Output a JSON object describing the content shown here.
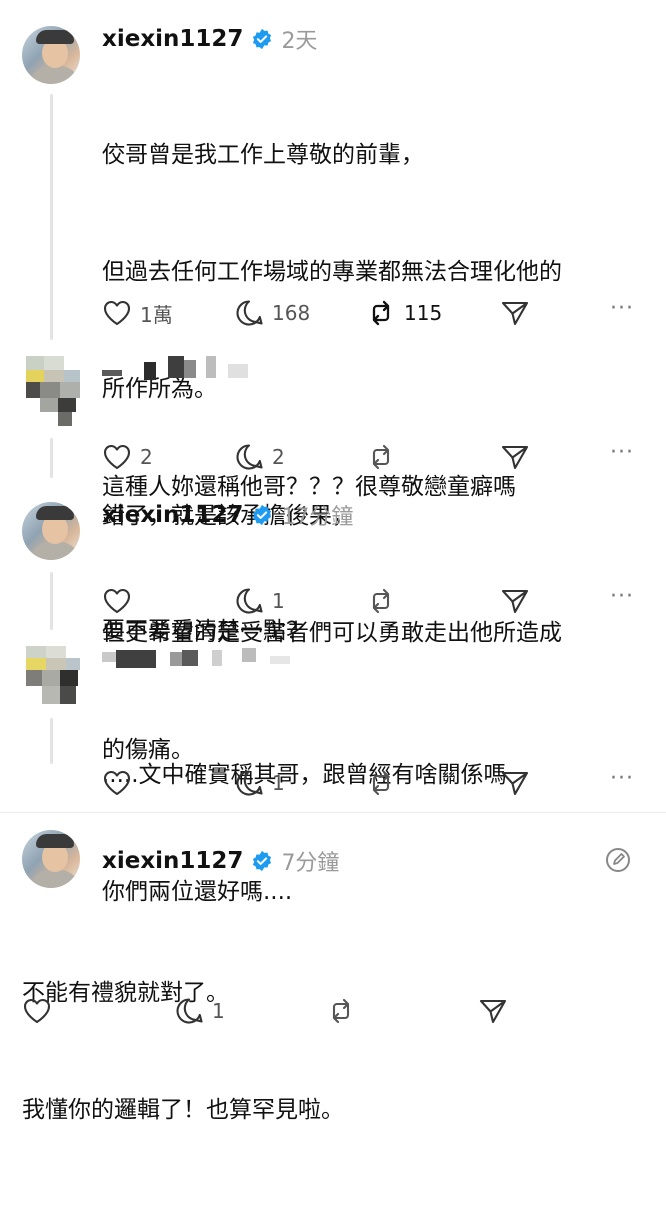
{
  "posts": [
    {
      "username": "xiexin1127",
      "time": "2天",
      "lines": [
        "佼哥曾是我工作上尊敬的前輩，",
        "但過去任何工作場域的專業都無法合理化他的",
        "所作所為。",
        "錯了，就是該承擔後果，",
        "但更希望的是受害者們可以勇敢走出他所造成",
        "的傷痛。"
      ],
      "likes": "1萬",
      "replies": "168",
      "reposts": "115",
      "more": "···"
    },
    {
      "username": "",
      "lines": [
        "這種人妳還稱他哥？？？很尊敬戀童癖嗎"
      ],
      "likes": "2",
      "replies": "2",
      "more": "···"
    },
    {
      "username": "xiexin1127",
      "time": "17分鐘",
      "lines": [
        "要不要看清楚一點？"
      ],
      "replies": "1",
      "more": "···"
    },
    {
      "username": "",
      "lines": [
        ".....文中確實稱其哥，跟曾經有啥關係嗎",
        "你們兩位還好嗎...."
      ],
      "replies": "1",
      "more": "···"
    },
    {
      "username": "xiexin1127",
      "time": "7分鐘",
      "lines": [
        "不能有禮貌就對了。",
        "我懂你的邏輯了！也算罕見啦。"
      ],
      "replies": "1"
    }
  ],
  "colors": {
    "verified": "#1d9bf0",
    "muted": "#9a9a9a",
    "text": "#111111"
  },
  "icons": [
    "heart-icon",
    "comment-icon",
    "repost-icon",
    "share-icon",
    "more-icon",
    "verified-icon",
    "edit-icon"
  ]
}
